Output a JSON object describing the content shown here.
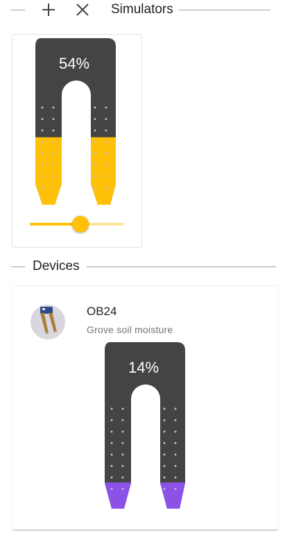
{
  "header": {
    "title": "Simulators",
    "add_icon": "plus-icon",
    "close_icon": "close-icon"
  },
  "simulator": {
    "moisture_percent": 54,
    "label": "54%",
    "slider_value": 0.54,
    "fill_color": "#ffc107",
    "track_color": "#ffe49a",
    "body_color": "#444444"
  },
  "devices_header": {
    "title": "Devices"
  },
  "device": {
    "name": "OB24",
    "type": "Grove soil moisture",
    "moisture_percent": 14,
    "label": "14%",
    "fill_color": "#8c52e8",
    "body_color": "#444444"
  }
}
